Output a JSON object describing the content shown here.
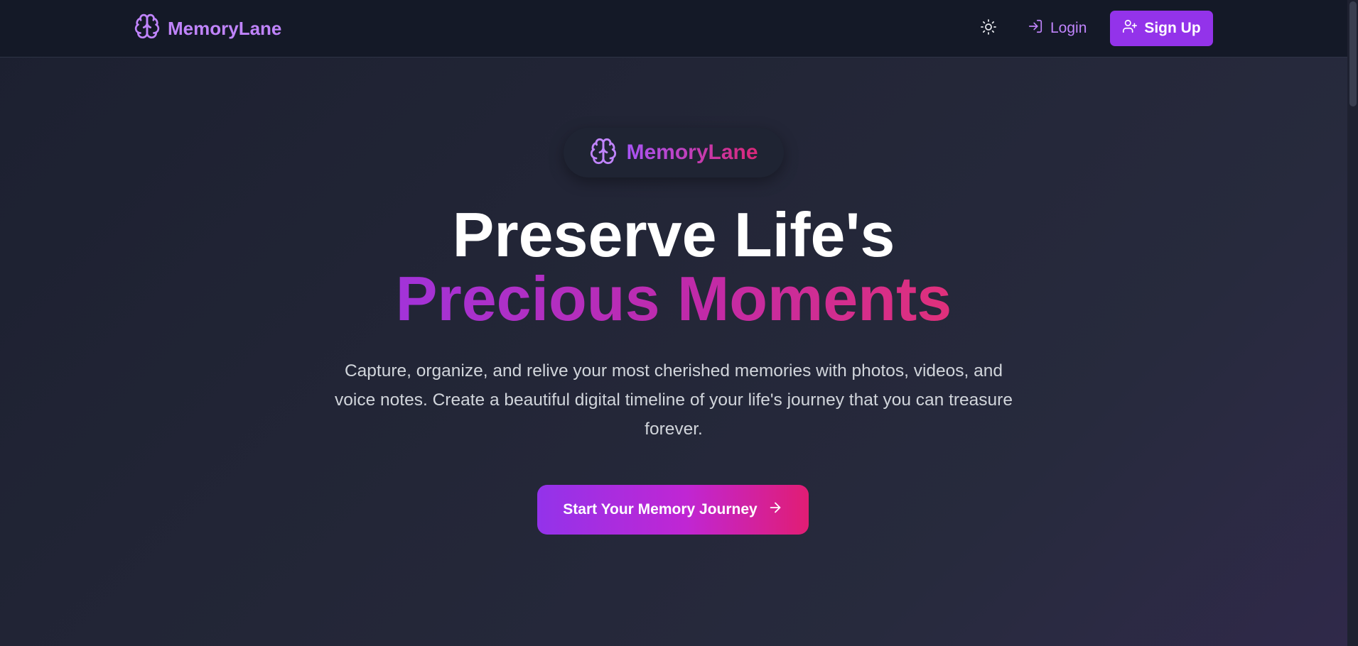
{
  "nav": {
    "brand_name": "MemoryLane",
    "brand_icon": "brain-icon",
    "theme_toggle_icon": "sun-icon",
    "login_label": "Login",
    "login_icon": "log-in-icon",
    "signup_label": "Sign Up",
    "signup_icon": "user-plus-icon"
  },
  "hero": {
    "badge_text": "MemoryLane",
    "badge_icon": "brain-icon",
    "headline_line1": "Preserve Life's",
    "headline_line2": "Precious Moments",
    "subtitle": "Capture, organize, and relive your most cherished memories with photos, videos, and voice notes. Create a beautiful digital timeline of your life's journey that you can treasure forever.",
    "cta_label": "Start Your Memory Journey",
    "cta_icon": "arrow-right-icon"
  },
  "colors": {
    "accent": "#9333ea",
    "accent_light": "#c084fc",
    "gradient_end": "#db2777",
    "nav_background": "#141927",
    "page_background": "#232637"
  }
}
